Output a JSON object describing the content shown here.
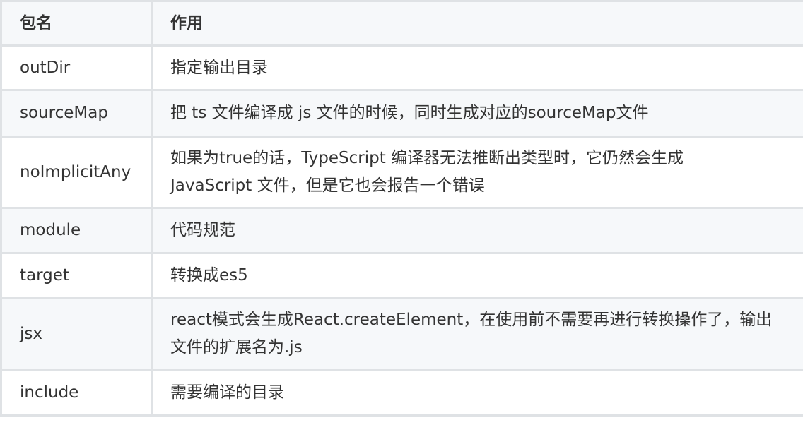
{
  "table": {
    "headers": [
      "包名",
      "作用"
    ],
    "rows": [
      {
        "name": "outDir",
        "desc": "指定输出目录"
      },
      {
        "name": "sourceMap",
        "desc": "把 ts 文件编译成 js 文件的时候，同时生成对应的sourceMap文件"
      },
      {
        "name": "noImplicitAny",
        "desc": "如果为true的话，TypeScript 编译器无法推断出类型时，它仍然会生成 JavaScript 文件，但是它也会报告一个错误"
      },
      {
        "name": "module",
        "desc": "代码规范"
      },
      {
        "name": "target",
        "desc": "转换成es5"
      },
      {
        "name": "jsx",
        "desc": "react模式会生成React.createElement，在使用前不需要再进行转换操作了，输出文件的扩展名为.js"
      },
      {
        "name": "include",
        "desc": "需要编译的目录"
      }
    ]
  }
}
